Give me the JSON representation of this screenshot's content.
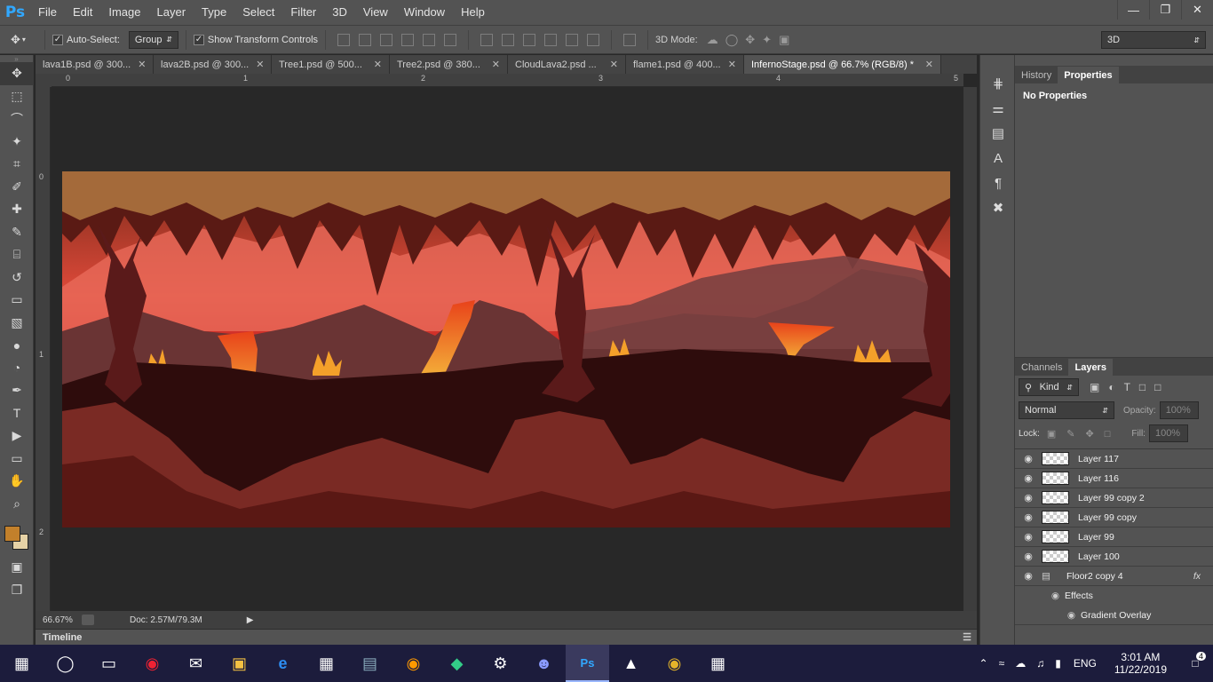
{
  "app": {
    "logo": "Ps"
  },
  "menu": [
    "File",
    "Edit",
    "Image",
    "Layer",
    "Type",
    "Select",
    "Filter",
    "3D",
    "View",
    "Window",
    "Help"
  ],
  "window_controls": [
    "minimize",
    "restore",
    "close"
  ],
  "options": {
    "auto_select_label": "Auto-Select:",
    "auto_select_checked": true,
    "auto_select_value": "Group",
    "show_transform_label": "Show Transform Controls",
    "show_transform_checked": true,
    "mode_3d_label": "3D Mode:",
    "workspace_value": "3D"
  },
  "tools": [
    "move-icon",
    "marquee-icon",
    "lasso-icon",
    "magic-wand-icon",
    "crop-icon",
    "eyedropper-icon",
    "healing-icon",
    "brush-icon",
    "stamp-icon",
    "history-brush-icon",
    "eraser-icon",
    "gradient-icon",
    "blur-icon",
    "dodge-icon",
    "pen-icon",
    "type-icon",
    "path-select-icon",
    "rectangle-icon",
    "hand-icon",
    "zoom-icon"
  ],
  "colors": {
    "foreground": "#c2802b",
    "background": "#e6d2a6",
    "ui_dark": "#282828",
    "ui_panel": "#535353",
    "accent": "#31a8ff"
  },
  "tabs": [
    {
      "label": "lava1B.psd @ 300...",
      "active": false
    },
    {
      "label": "lava2B.psd @ 300...",
      "active": false
    },
    {
      "label": "Tree1.psd @ 500...",
      "active": false
    },
    {
      "label": "Tree2.psd @ 380...",
      "active": false
    },
    {
      "label": "CloudLava2.psd ...",
      "active": false
    },
    {
      "label": "flame1.psd @ 400...",
      "active": false
    },
    {
      "label": "InfernoStage.psd @ 66.7% (RGB/8) *",
      "active": true
    }
  ],
  "ruler": {
    "h_ticks": [
      "0",
      "1",
      "2",
      "3",
      "4",
      "5"
    ],
    "v_ticks": [
      "0",
      "1",
      "2"
    ]
  },
  "status": {
    "zoom": "66.67%",
    "doc": "Doc: 2.57M/79.3M"
  },
  "timeline_label": "Timeline",
  "panels": {
    "top_tabs": [
      "History",
      "Properties"
    ],
    "top_active": "Properties",
    "properties_text": "No Properties",
    "layers_tabs": [
      "Channels",
      "Layers"
    ],
    "layers_active": "Layers",
    "filter_kind": "Kind",
    "blend_mode": "Normal",
    "opacity_label": "Opacity:",
    "opacity_value": "100%",
    "lock_label": "Lock:",
    "fill_label": "Fill:",
    "fill_value": "100%",
    "layers": [
      {
        "name": "Layer 117"
      },
      {
        "name": "Layer 116"
      },
      {
        "name": "Layer 99 copy 2"
      },
      {
        "name": "Layer 99 copy"
      },
      {
        "name": "Layer 99"
      },
      {
        "name": "Layer 100"
      }
    ],
    "group_layer": "Floor2 copy 4",
    "effects_label": "Effects",
    "effect_item": "Gradient Overlay",
    "fx_label": "fx"
  },
  "taskbar": {
    "apps": [
      "windows-icon",
      "search-icon",
      "task-view-icon",
      "app1-icon",
      "mail-icon",
      "explorer-icon",
      "edge-icon",
      "store-icon",
      "app2-icon",
      "app3-icon",
      "app4-icon",
      "steam-icon",
      "discord-icon",
      "photoshop-icon",
      "photos-icon",
      "chrome-icon",
      "calculator-icon"
    ],
    "lang": "ENG",
    "time": "3:01 AM",
    "date": "11/22/2019",
    "notifications": "4"
  }
}
